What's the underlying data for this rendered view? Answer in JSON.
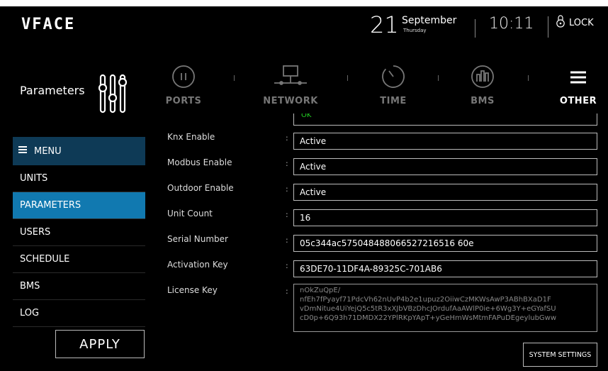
{
  "brand": {
    "logo": "VFACE"
  },
  "clock": {
    "day": "21",
    "month": "September",
    "weekday": "Thursday",
    "time": "10:11",
    "lock_label": "LOCK"
  },
  "page": {
    "title": "Parameters"
  },
  "tabs": [
    {
      "label": "PORTS",
      "icon": "pause-circle-icon",
      "active": false
    },
    {
      "label": "NETWORK",
      "icon": "network-icon",
      "active": false
    },
    {
      "label": "TIME",
      "icon": "timer-icon",
      "active": false
    },
    {
      "label": "BMS",
      "icon": "building-icon",
      "active": false
    },
    {
      "label": "OTHER",
      "icon": "hamburger-icon",
      "active": true
    }
  ],
  "sidebar": {
    "menu_label": "MENU",
    "items": [
      {
        "label": "UNITS",
        "active": false
      },
      {
        "label": "PARAMETERS",
        "active": true
      },
      {
        "label": "USERS",
        "active": false
      },
      {
        "label": "SCHEDULE",
        "active": false
      },
      {
        "label": "BMS",
        "active": false
      },
      {
        "label": "LOG",
        "active": false
      }
    ],
    "apply_label": "APPLY"
  },
  "form": {
    "status_text": "OK",
    "colon": ":",
    "fields": [
      {
        "label": "Knx Enable",
        "value": "Active"
      },
      {
        "label": "Modbus Enable",
        "value": "Active"
      },
      {
        "label": "Outdoor Enable",
        "value": "Active"
      },
      {
        "label": "Unit Count",
        "value": "16"
      },
      {
        "label": "Serial Number",
        "value": "05c344ac575048488066527216516 60e"
      },
      {
        "label": "Activation Key",
        "value": "63DE70-11DF4A-89325C-701AB6"
      }
    ],
    "license_label": "License Key",
    "license_value": "nOkZuQpE/\nnfEh7fPyayf71PdcVh62nUvP4b2e1upuz2OiiwCzMKWsAwP3ABhBXaD1F\nvDmNitue4UiYejQ5c5tR3xXJbVBzDhcJOrdufAaAWlP0ie+6Wg3Y+eGYafSU\ncD0p+6Q93h71DMDX22YPlRKpYApT+yGeHmWsMtmFAPuDEgeylubGww",
    "system_settings_label": "SYSTEM SETTINGS"
  },
  "colors": {
    "accent": "#1179b0",
    "menu_header": "#0e3a56",
    "ok_text": "#22cc22",
    "background": "#000000"
  }
}
